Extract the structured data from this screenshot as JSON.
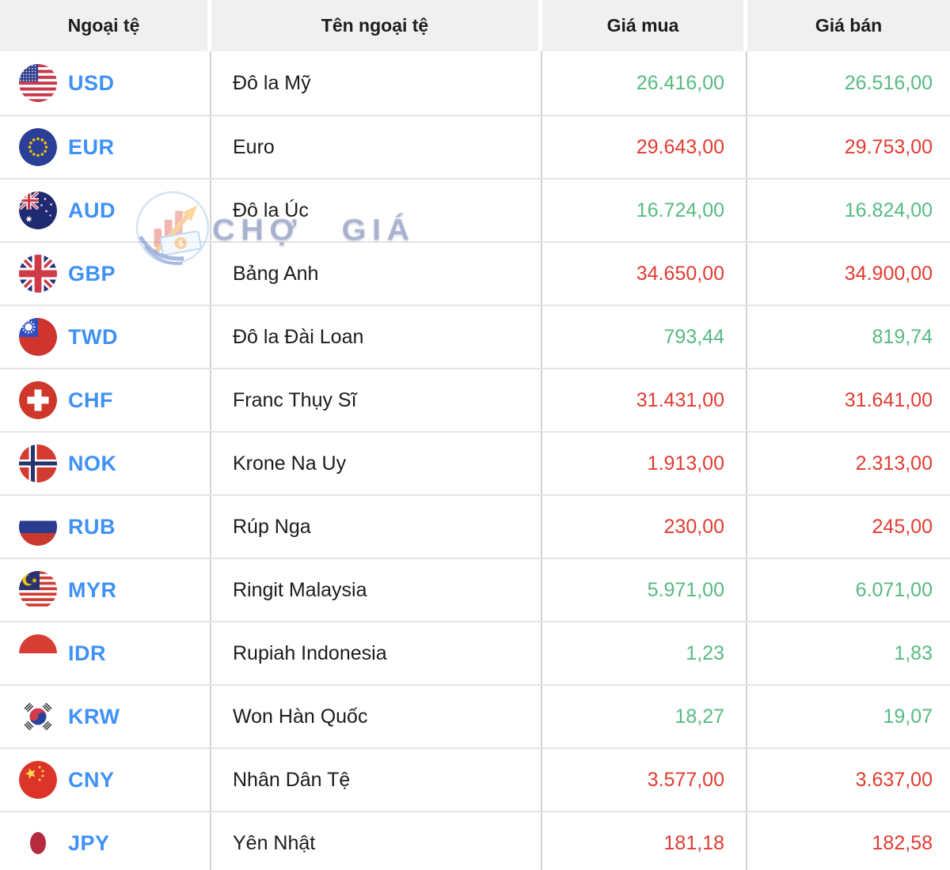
{
  "table": {
    "columns": [
      "Ngoại tệ",
      "Tên ngoại tệ",
      "Giá mua",
      "Giá bán"
    ],
    "rows": [
      {
        "code": "USD",
        "flag": "us-flag-icon",
        "name": "Đô la Mỹ",
        "buy": "26.416,00",
        "sell": "26.516,00",
        "trend": "up"
      },
      {
        "code": "EUR",
        "flag": "eu-flag-icon",
        "name": "Euro",
        "buy": "29.643,00",
        "sell": "29.753,00",
        "trend": "down"
      },
      {
        "code": "AUD",
        "flag": "australia-flag-icon",
        "name": "Đô la Úc",
        "buy": "16.724,00",
        "sell": "16.824,00",
        "trend": "up"
      },
      {
        "code": "GBP",
        "flag": "uk-flag-icon",
        "name": "Bảng Anh",
        "buy": "34.650,00",
        "sell": "34.900,00",
        "trend": "down"
      },
      {
        "code": "TWD",
        "flag": "taiwan-flag-icon",
        "name": "Đô la Đài Loan",
        "buy": "793,44",
        "sell": "819,74",
        "trend": "up"
      },
      {
        "code": "CHF",
        "flag": "switzerland-flag-icon",
        "name": "Franc Thụy Sĩ",
        "buy": "31.431,00",
        "sell": "31.641,00",
        "trend": "down"
      },
      {
        "code": "NOK",
        "flag": "norway-flag-icon",
        "name": "Krone Na Uy",
        "buy": "1.913,00",
        "sell": "2.313,00",
        "trend": "down"
      },
      {
        "code": "RUB",
        "flag": "russia-flag-icon",
        "name": "Rúp Nga",
        "buy": "230,00",
        "sell": "245,00",
        "trend": "down"
      },
      {
        "code": "MYR",
        "flag": "malaysia-flag-icon",
        "name": "Ringit Malaysia",
        "buy": "5.971,00",
        "sell": "6.071,00",
        "trend": "up"
      },
      {
        "code": "IDR",
        "flag": "indonesia-flag-icon",
        "name": "Rupiah Indonesia",
        "buy": "1,23",
        "sell": "1,83",
        "trend": "up"
      },
      {
        "code": "KRW",
        "flag": "south-korea-flag-icon",
        "name": "Won Hàn Quốc",
        "buy": "18,27",
        "sell": "19,07",
        "trend": "up"
      },
      {
        "code": "CNY",
        "flag": "china-flag-icon",
        "name": "Nhân Dân Tệ",
        "buy": "3.577,00",
        "sell": "3.637,00",
        "trend": "down"
      },
      {
        "code": "JPY",
        "flag": "japan-flag-icon",
        "name": "Yên Nhật",
        "buy": "181,18",
        "sell": "182,58",
        "trend": "down"
      }
    ]
  },
  "watermark": {
    "text": "CHỢ GIÁ"
  },
  "colors": {
    "up": "#57ba81",
    "down": "#e23b31",
    "code": "#3f91f6"
  }
}
